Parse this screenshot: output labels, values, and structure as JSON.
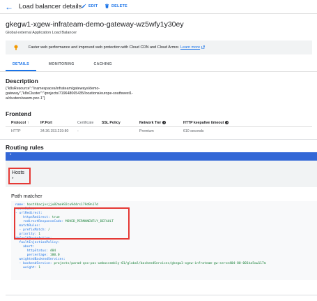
{
  "header": {
    "title": "Load balancer details",
    "edit_label": "EDIT",
    "delete_label": "DELETE"
  },
  "resource": {
    "name": "gkegw1-xgew-infrateam-demo-gateway-wz5wfy1y30ey",
    "type": "Global external Application Load Balancer"
  },
  "banner": {
    "text": "Faster web performance and improved web protection with Cloud CDN and Cloud Armor.",
    "link": "Learn more"
  },
  "tabs": [
    {
      "label": "DETAILS",
      "active": true
    },
    {
      "label": "MONITORING",
      "active": false
    },
    {
      "label": "CACHING",
      "active": false
    }
  ],
  "description": {
    "title": "Description",
    "lines": [
      "{\"k8sResource\":\"/namespaces/infrateam/gateways/demo-",
      "gateway\",\"k8sCluster\":\"/projects/719648065435/locations/europe-southwest1-",
      "a/clusters/wasm-poc-1\"}"
    ]
  },
  "frontend": {
    "title": "Frontend",
    "columns": [
      "Protocol",
      "IP:Port",
      "Certificate",
      "SSL Policy",
      "Network Tier",
      "HTTP keepalive timeout"
    ],
    "rows": [
      [
        "HTTP",
        "34.36.153.219:80",
        "-",
        "",
        "Premium",
        "610 seconds"
      ]
    ]
  },
  "routing": {
    "title": "Routing rules",
    "bar_text": "*",
    "hosts_label": "Hosts",
    "hosts_value": "*",
    "path_matcher_title": "Path matcher"
  },
  "yaml_lines": [
    {
      "k": "name: ",
      "v": "host4bacjvsjju82mak92cu944rs179d9n17d"
    },
    {
      "k": "routeRules:",
      "v": ""
    },
    {
      "k": "- urlRedirect:",
      "v": ""
    },
    {
      "k": "    httpsRedirect: ",
      "v": "true"
    },
    {
      "k": "    redirectResponseCode: ",
      "v": "MOVED_PERMANENTLY_DEFAULT"
    },
    {
      "k": "  matchRules:",
      "v": ""
    },
    {
      "k": "  - prefixMatch: ",
      "v": "/"
    },
    {
      "k": "  priority: ",
      "v": "1"
    },
    {
      "k": "defaultRouteAction:",
      "v": ""
    },
    {
      "k": "  faultInjectionPolicy:",
      "v": ""
    },
    {
      "k": "    abort:",
      "v": ""
    },
    {
      "k": "      httpStatus: ",
      "v": "404"
    },
    {
      "k": "      percentage: ",
      "v": "100.0"
    },
    {
      "k": "  weightedBackendServices:",
      "v": ""
    },
    {
      "k": "  - backendService: ",
      "v": "projects/parad-qso-poc-webassembly-01/global/backendServices/gkegw1-xgew-infrateam-gw-serve404-80-001ka5ow117m"
    },
    {
      "k": "    weight: ",
      "v": "1"
    }
  ],
  "colors": {
    "accent": "#1a73e8",
    "highlight_border": "#e53935",
    "routing_bar": "#3367d6"
  }
}
